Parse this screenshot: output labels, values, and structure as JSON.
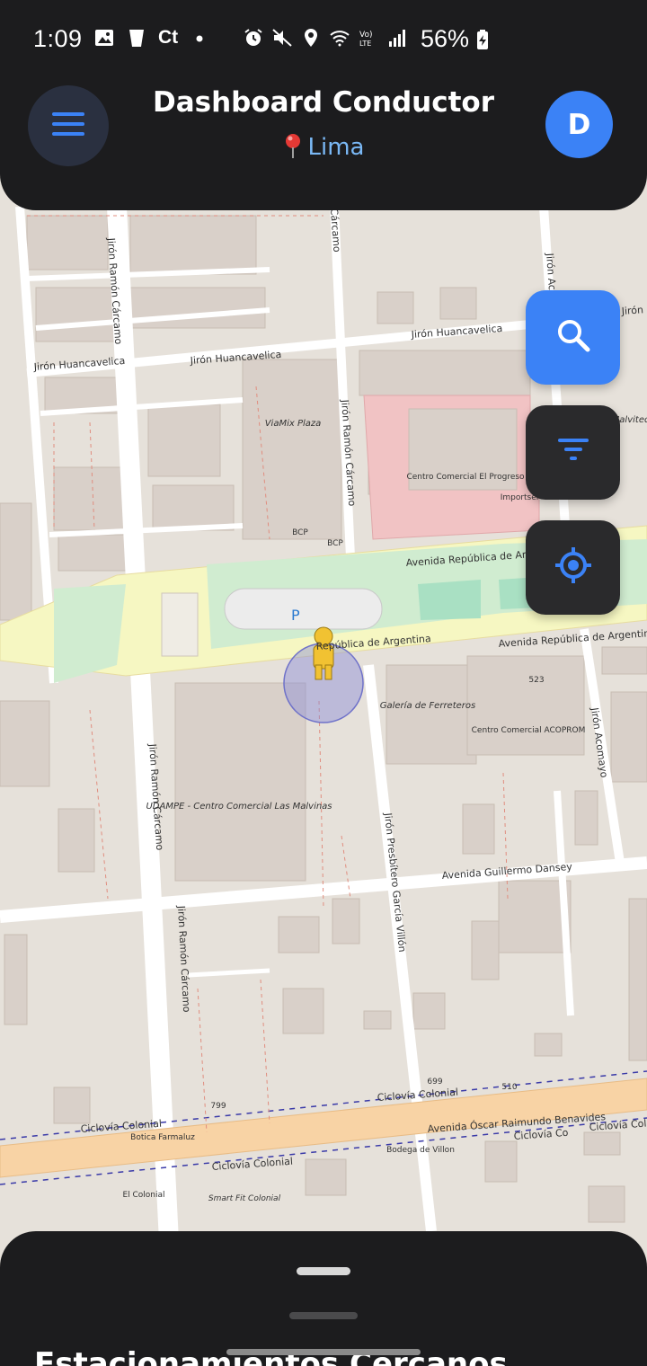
{
  "status_bar": {
    "time": "1:09",
    "ct_label": "Ct",
    "battery": "56%",
    "icons": [
      "image-icon",
      "cup-icon",
      "dot-icon",
      "alarm-icon",
      "mute-icon",
      "location-icon",
      "wifi-icon",
      "volte-icon",
      "signal-icon",
      "battery-charging-icon"
    ]
  },
  "header": {
    "title": "Dashboard Conductor",
    "location": "Lima",
    "avatar_initial": "D",
    "colors": {
      "background": "#1c1c1e",
      "accent": "#3b82f6",
      "location_text": "#7ab8f5"
    }
  },
  "fabs": {
    "search_icon": "search-icon",
    "filter_icon": "filter-icon",
    "locate_icon": "crosshair-icon"
  },
  "map": {
    "streets": {
      "jiron_ramon_carcamo": "Jirón Ramón Cárcamo",
      "carcamo": "Cárcamo",
      "jiron_huancavelica": "Jirón Huancavelica",
      "jiron_huancavelica_short": "Jirón Huancavelica",
      "av_republica_argentina": "Avenida República de Argentina",
      "av_republica_arg_short": "Avenida República de Arg",
      "av_republica_argentina_mid": "República de Argentina",
      "jiron_acomayo": "Jirón Acomayo",
      "jiron_presbitero": "Jirón Presbítero García Villón",
      "av_guillermo_dansey": "Avenida Guillermo Dansey",
      "av_oscar_benavides": "Avenida Óscar Raimundo Benavides",
      "ciclovia_colonial": "Ciclovía Colonial",
      "ciclovia_co": "Ciclovía Co",
      "jiron_ac": "Jirón Ac",
      "jiron_partial": "Jirón"
    },
    "places": {
      "viamix": "ViaMix Plaza",
      "centro_progreso": "Centro Comercial El Progreso",
      "importsel": "Importsel",
      "bcp1": "BCP",
      "bcp2": "BCP",
      "galeria_ferreteros": "Galería de Ferreteros",
      "centro_acoprom": "Centro Comercial ACOPROM",
      "udampe": "UDAMPE - Centro Comercial Las Malvinas",
      "botica": "Botica Farmaluz",
      "bodega": "Bodega de Villon",
      "el_colonial": "El Colonial",
      "smart_fit": "Smart Fit Colonial",
      "malvited": "Malvited",
      "parking": "P"
    },
    "house_numbers": [
      "523",
      "699",
      "510",
      "799"
    ]
  },
  "bottom_sheet": {
    "title": "Estacionamientos Cercanos"
  }
}
